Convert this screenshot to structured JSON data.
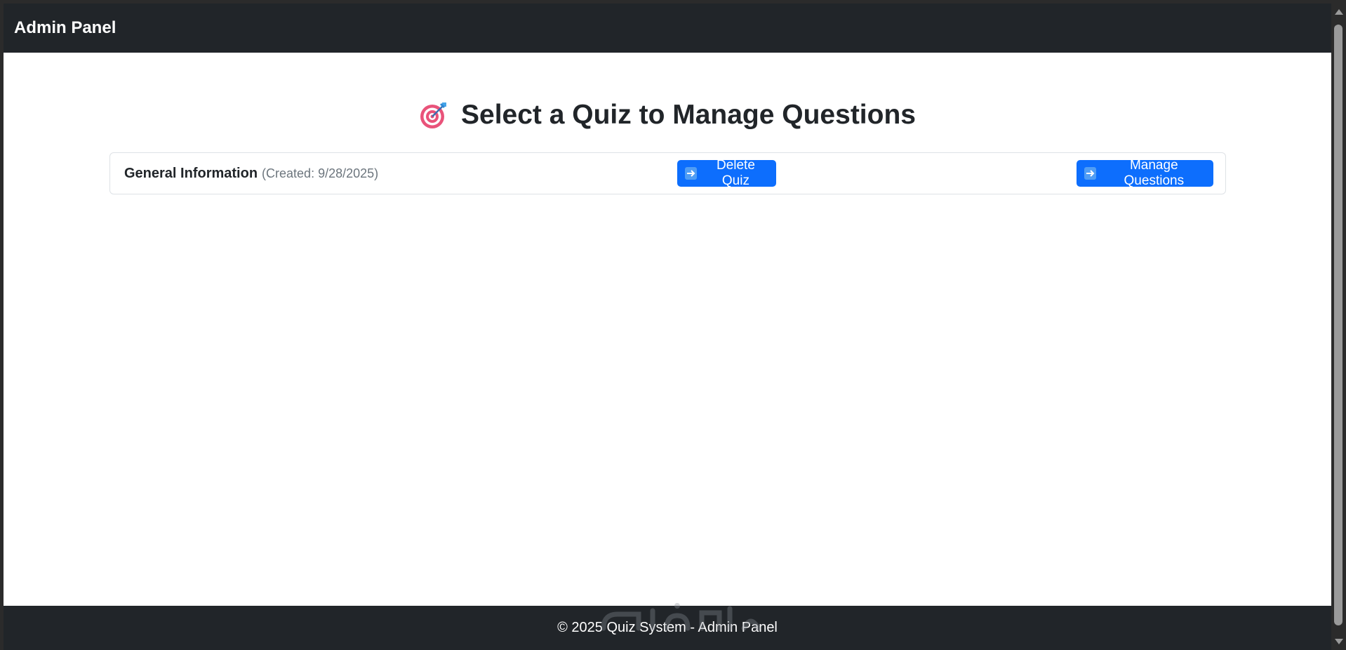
{
  "navbar": {
    "brand": "Admin Panel"
  },
  "main": {
    "title": "Select a Quiz to Manage Questions",
    "title_icon": "target-icon"
  },
  "quizzes": [
    {
      "name": "General Information",
      "created": "(Created: 9/28/2025)",
      "delete_label": "Delete Quiz",
      "manage_label": "Manage Questions",
      "button_icon": "right-arrow-icon"
    }
  ],
  "footer": {
    "text": "© 2025 Quiz System - Admin Panel"
  },
  "colors": {
    "navbar_bg": "#212529",
    "primary": "#0d6efd",
    "muted": "#6c757d"
  }
}
